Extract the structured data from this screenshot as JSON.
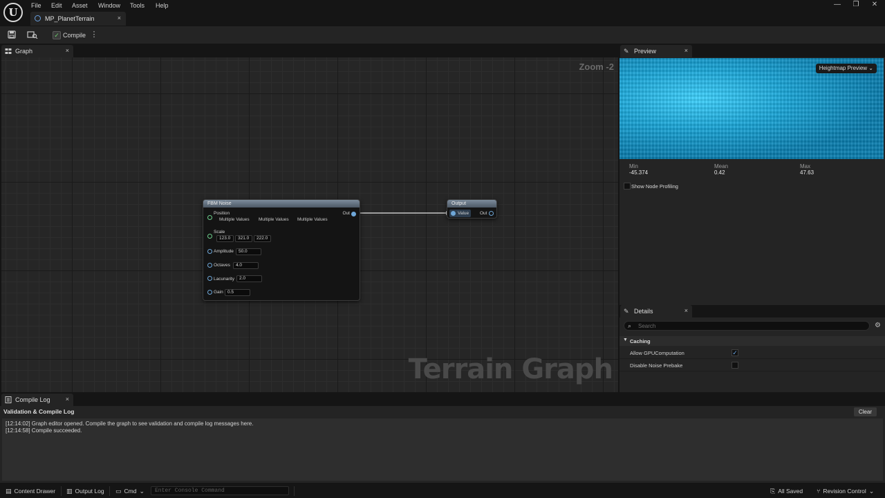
{
  "menu": {
    "logo": "U",
    "items": [
      "File",
      "Edit",
      "Asset",
      "Window",
      "Tools",
      "Help"
    ]
  },
  "asset_tab": {
    "label": "MP_PlanetTerrain",
    "close": "×"
  },
  "window_controls": {
    "minimize": "—",
    "maximize": "❐",
    "close": "✕"
  },
  "toolbar": {
    "compile_label": "Compile",
    "more": "⋮"
  },
  "graph_panel": {
    "tab_label": "Graph",
    "close": "×",
    "zoom": "Zoom -2",
    "watermark": "Terrain Graph"
  },
  "nodes": {
    "fbm": {
      "title": "FBM Noise",
      "out_label": "Out",
      "position": {
        "label": "Position",
        "values": [
          "Multiple Values",
          "Multiple Values",
          "Multiple Values"
        ]
      },
      "scale": {
        "label": "Scale",
        "values": [
          "123.0",
          "321.0",
          "222.0"
        ]
      },
      "amplitude": {
        "label": "Amplitude",
        "value": "50.0"
      },
      "octaves": {
        "label": "Octaves",
        "value": "4.0"
      },
      "lacunarity": {
        "label": "Lacunarity",
        "value": "2.0"
      },
      "gain": {
        "label": "Gain",
        "value": "0.5"
      }
    },
    "output": {
      "title": "Output",
      "value_label": "Value",
      "out_label": "Out"
    }
  },
  "preview": {
    "tab_label": "Preview",
    "close": "×",
    "dropdown": "Heightmap Preview",
    "stats": [
      {
        "label": "Min",
        "value": "-45.374"
      },
      {
        "label": "Mean",
        "value": "0.42"
      },
      {
        "label": "Max",
        "value": "47.63"
      }
    ],
    "profiling_label": "Show Node Profiling",
    "profiling_checked": false
  },
  "details": {
    "tab_label": "Details",
    "close": "×",
    "search_placeholder": "Search",
    "section": "Caching",
    "props": [
      {
        "label": "Allow GPUComputation",
        "checked": true
      },
      {
        "label": "Disable Noise Prebake",
        "checked": false
      }
    ]
  },
  "log": {
    "tab_label": "Compile Log",
    "close": "×",
    "title": "Validation & Compile Log",
    "clear_label": "Clear",
    "lines": [
      "[12:14:02] Graph editor opened. Compile the graph to see validation and compile log messages here.",
      "[12:14:58] Compile succeeded."
    ]
  },
  "statusbar": {
    "content_drawer": "Content Drawer",
    "output_log": "Output Log",
    "cmd": "Cmd",
    "console_placeholder": "Enter Console Command",
    "saved": "All Saved",
    "revision": "Revision Control"
  },
  "colors": {
    "accent_blue": "#6fa7d8",
    "pin_green": "#6dcf8c",
    "check_blue": "#6aa7e8",
    "heightmap_cyan": "#1aa6d8"
  }
}
